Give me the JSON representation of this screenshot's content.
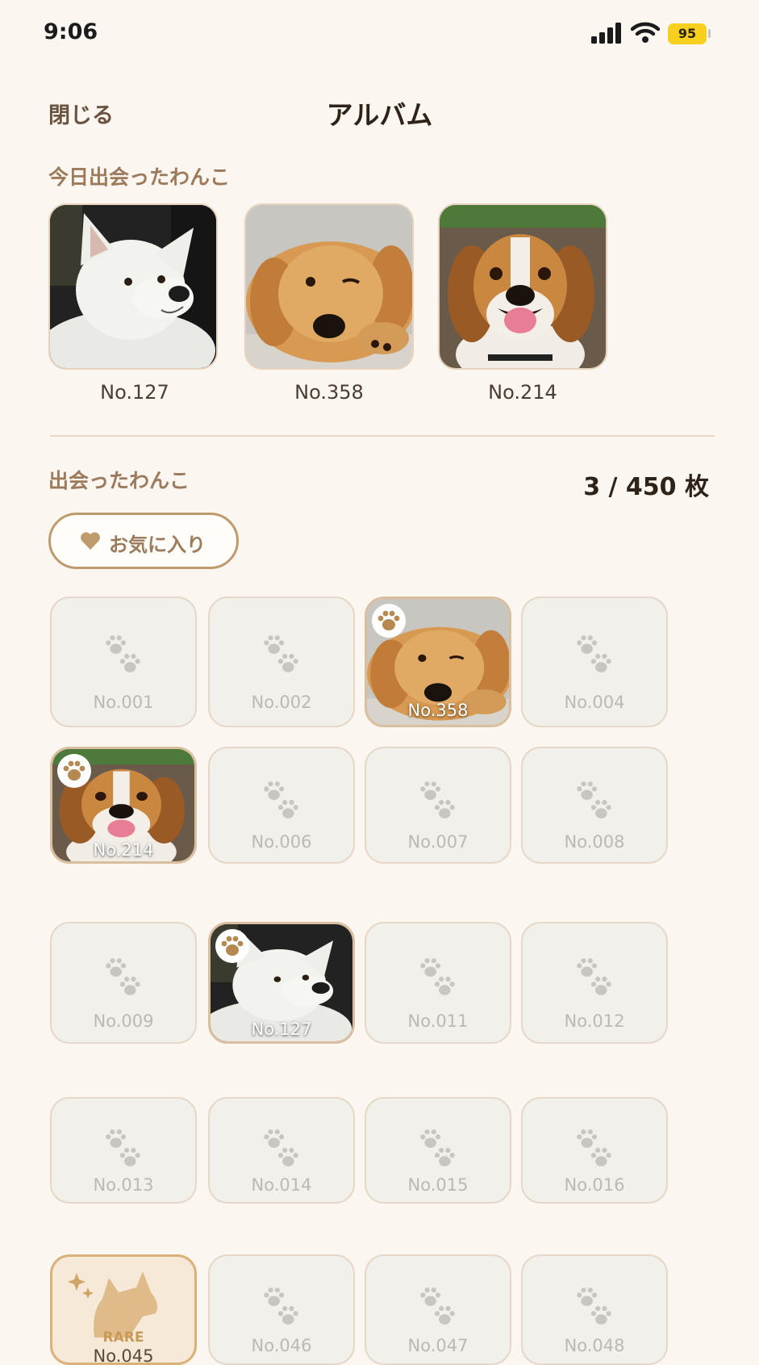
{
  "status_bar": {
    "time": "9:06",
    "battery": "95"
  },
  "header": {
    "close_label": "閉じる",
    "title": "アルバム"
  },
  "today": {
    "section_label": "今日出会ったわんこ",
    "dogs": [
      {
        "number": "No.127",
        "breed_icon": "white-dog"
      },
      {
        "number": "No.358",
        "breed_icon": "golden-dog"
      },
      {
        "number": "No.214",
        "breed_icon": "beagle-dog"
      }
    ]
  },
  "collection": {
    "section_label": "出会ったわんこ",
    "count": "3 / 450 枚",
    "favorite_label": "お気に入り",
    "rare_label": "RARE",
    "cells": [
      {
        "number": "No.001",
        "state": "locked"
      },
      {
        "number": "No.002",
        "state": "locked"
      },
      {
        "number": "No.358",
        "state": "photo",
        "dog": "golden-dog"
      },
      {
        "number": "No.004",
        "state": "locked"
      },
      {
        "number": "No.214",
        "state": "photo",
        "dog": "beagle-dog"
      },
      {
        "number": "No.006",
        "state": "locked"
      },
      {
        "number": "No.007",
        "state": "locked"
      },
      {
        "number": "No.008",
        "state": "locked"
      },
      {
        "number": "No.009",
        "state": "locked"
      },
      {
        "number": "No.127",
        "state": "photo",
        "dog": "white-dog"
      },
      {
        "number": "No.011",
        "state": "locked"
      },
      {
        "number": "No.012",
        "state": "locked"
      },
      {
        "number": "No.013",
        "state": "locked"
      },
      {
        "number": "No.014",
        "state": "locked"
      },
      {
        "number": "No.015",
        "state": "locked"
      },
      {
        "number": "No.016",
        "state": "locked"
      },
      {
        "number": "No.045",
        "state": "rare"
      },
      {
        "number": "No.046",
        "state": "locked"
      },
      {
        "number": "No.047",
        "state": "locked"
      },
      {
        "number": "No.048",
        "state": "locked"
      }
    ]
  },
  "colors": {
    "accent": "#bf9a6c",
    "background": "#fcf6f0",
    "rare": "#d9b27a"
  }
}
